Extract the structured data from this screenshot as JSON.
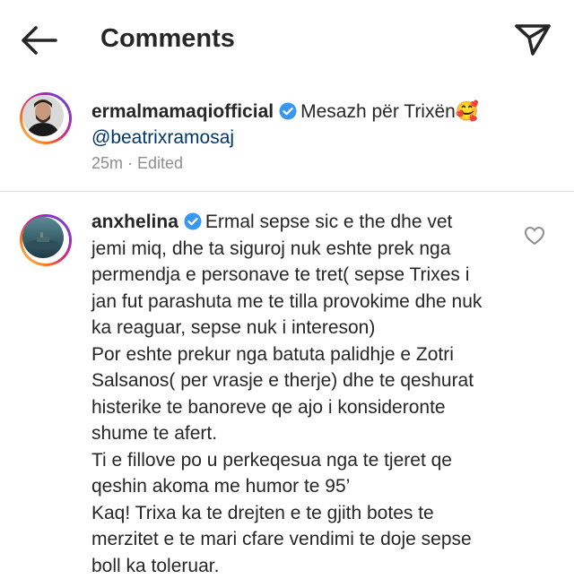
{
  "header": {
    "title": "Comments"
  },
  "caption": {
    "username": "ermalmamaqiofficial",
    "text": "Mesazh për Trixën🥰",
    "mention": "@beatrixramosaj",
    "time": "25m",
    "edited": "Edited"
  },
  "comment": {
    "username": "anxhelina",
    "lines": [
      "Ermal sepse sic e the dhe vet",
      "jemi miq, dhe ta siguroj nuk eshte prek nga",
      "permendja e personave te tret( sepse Trixes i",
      "jan fut parashuta me te tilla provokime dhe nuk",
      "ka reaguar, sepse nuk i intereson)",
      "Por eshte prekur nga batuta palidhje e Zotri",
      "Salsanos( per vrasje e therje) dhe  te qeshurat",
      "histerike te banoreve qe ajo i konsideronte",
      "shume te afert.",
      "Ti e fillove po u perkeqesua nga te tjeret qe",
      "qeshin akoma me humor te 95’",
      "Kaq! Trixa ka te drejten e te gjith botes te",
      "merzitet e te mari cfare vendimi te doje sepse",
      "boll ka toleruar."
    ]
  },
  "colors": {
    "verified": "#3897f0",
    "mention": "#00376b",
    "meta": "#8e8e8e"
  }
}
